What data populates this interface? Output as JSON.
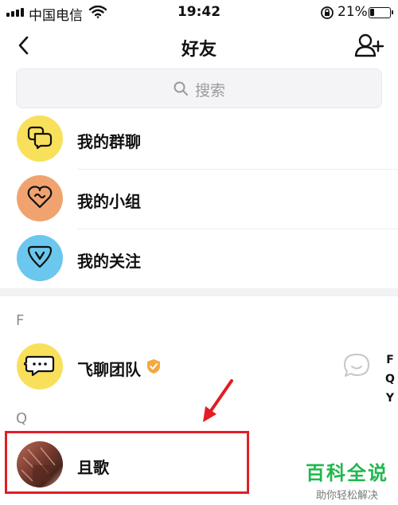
{
  "status_bar": {
    "carrier": "中国电信",
    "time": "19:42",
    "battery_percent": "21%",
    "battery_level": 0.21
  },
  "nav": {
    "title": "好友"
  },
  "search": {
    "placeholder": "搜索"
  },
  "menu": {
    "items": [
      {
        "label": "我的群聊",
        "icon": "group-chat-icon",
        "color": "#f9e05b"
      },
      {
        "label": "我的小组",
        "icon": "group-heart-icon",
        "color": "#f0a36f"
      },
      {
        "label": "我的关注",
        "icon": "follow-v-icon",
        "color": "#6cc7ef"
      }
    ]
  },
  "sections": [
    {
      "letter": "F",
      "friends": [
        {
          "name": "飞聊团队",
          "verified": true,
          "avatar": "feiliao-bot-icon",
          "avatar_color": "#f9e05b"
        }
      ]
    },
    {
      "letter": "Q",
      "friends": [
        {
          "name": "且歌",
          "verified": false,
          "avatar": "photo-avatar",
          "avatar_color": "#8a4a3a"
        }
      ]
    }
  ],
  "index_letters": [
    "F",
    "Q",
    "Y"
  ],
  "colors": {
    "highlight": "#e21d24",
    "verified_badge": "#f5a83b",
    "watermark_green": "#1fb84d"
  },
  "watermark": {
    "line1": "百科全说",
    "line2": "助你轻松解决"
  }
}
